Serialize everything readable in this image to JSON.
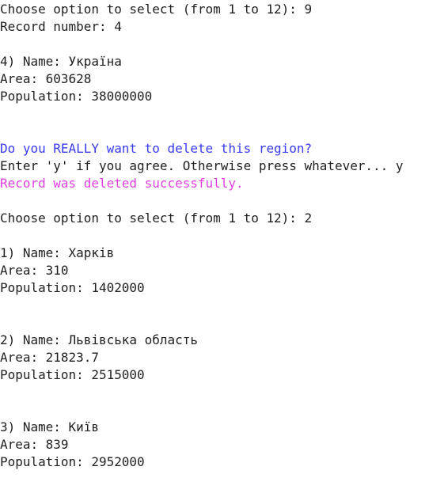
{
  "colors": {
    "background": "#ffffff",
    "text": "#1f1f1f",
    "prompt_question": "#3a3af0",
    "success": "#e040e0"
  },
  "lines": [
    "Choose option to select (from 1 to 12): 9",
    "Record number: 4",
    "4) Name: Україна",
    "Area: 603628",
    "Population: 38000000",
    "Do you REALLY want to delete this region?",
    "Enter 'y' if you agree. Otherwise press whatever... y",
    "Record was deleted successfully.",
    "Choose option to select (from 1 to 12): 2",
    "1) Name: Харків",
    "Area: 310",
    "Population: 1402000",
    "2) Name: Львівська область",
    "Area: 21823.7",
    "Population: 2515000",
    "3) Name: Київ",
    "Area: 839",
    "Population: 2952000"
  ]
}
